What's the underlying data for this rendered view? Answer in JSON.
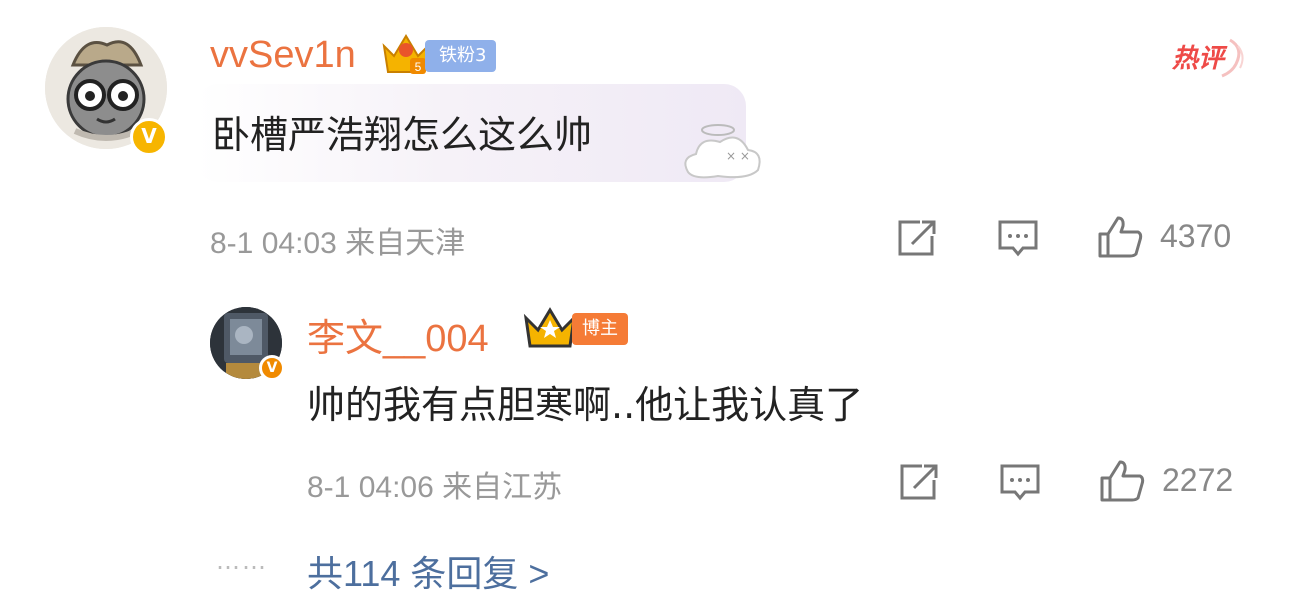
{
  "comment": {
    "username": "vvSev1n",
    "fan_badge": "铁粉3",
    "crown_level": "5",
    "hot_tag": "热评",
    "text": "卧槽严浩翔怎么这么帅",
    "time": "8-1 04:03",
    "location": "来自天津",
    "likes": "4370",
    "verified_mark": "V"
  },
  "reply": {
    "username": "李文__004",
    "blogger_badge": "博主",
    "text": "帅的我有点胆寒啊..他让我认真了",
    "time": "8-1 04:06",
    "location": "来自江苏",
    "likes": "2272",
    "verified_mark": "V"
  },
  "more_replies": {
    "dots": "……",
    "label": "共114 条回复 >"
  },
  "colors": {
    "username": "#eb7340",
    "link": "#4d6f9e",
    "meta": "#999999",
    "hot": "#ee4a47"
  },
  "icons": [
    "repost-icon",
    "comment-icon",
    "like-icon",
    "verified-icon",
    "crown-icon",
    "hot-tag-icon"
  ]
}
